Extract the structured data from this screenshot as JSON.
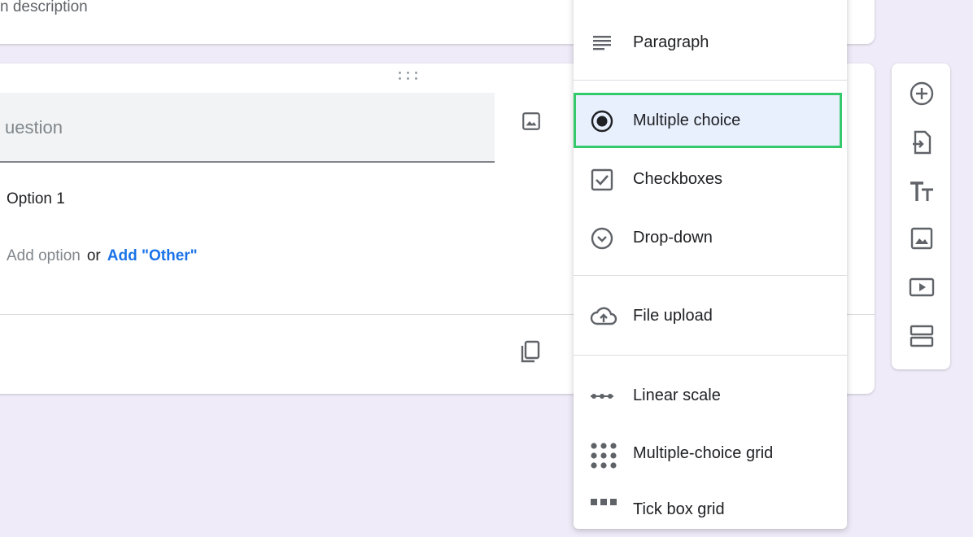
{
  "form": {
    "description_partial": "n description",
    "question_placeholder_partial": "uestion",
    "option_1": "Option 1",
    "add_option": "Add option",
    "or_text": "or",
    "add_other": "Add \"Other\""
  },
  "type_menu": {
    "items": [
      {
        "label": "Paragraph",
        "icon": "paragraph-icon"
      },
      {
        "label": "Multiple choice",
        "icon": "radio-button-icon",
        "selected": true
      },
      {
        "label": "Checkboxes",
        "icon": "checkbox-icon"
      },
      {
        "label": "Drop-down",
        "icon": "dropdown-circle-icon"
      },
      {
        "label": "File upload",
        "icon": "cloud-upload-icon"
      },
      {
        "label": "Linear scale",
        "icon": "linear-scale-icon"
      },
      {
        "label": "Multiple-choice grid",
        "icon": "grid-dots-icon"
      },
      {
        "label": "Tick box grid",
        "icon": "tick-grid-icon"
      }
    ],
    "highlight_color": "#34c96b",
    "selected_bg": "#e8f0fe"
  },
  "toolbar": {
    "buttons": [
      "add-question-icon",
      "import-questions-icon",
      "title-text-icon",
      "image-icon",
      "video-icon",
      "section-icon"
    ]
  },
  "colors": {
    "background": "#efebf8",
    "link": "#1a73e8",
    "icon": "#5f6368"
  }
}
